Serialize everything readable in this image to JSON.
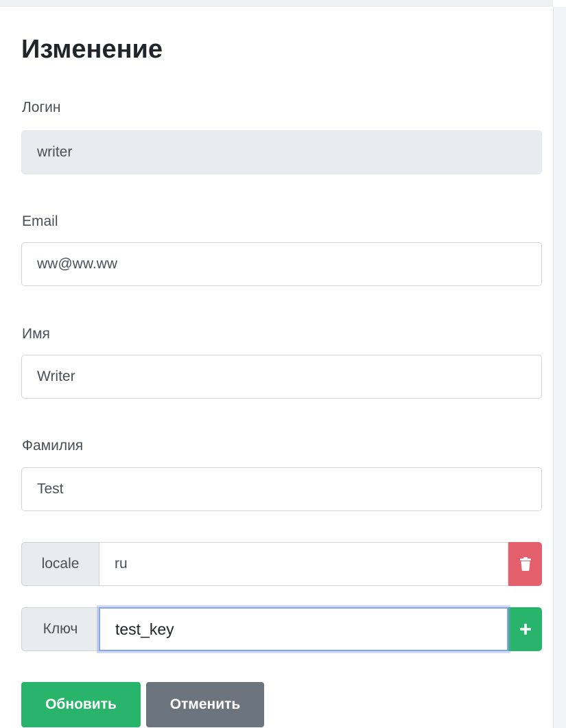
{
  "form": {
    "title": "Изменение",
    "login": {
      "label": "Логин",
      "value": "writer"
    },
    "email": {
      "label": "Email",
      "value": "ww@ww.ww"
    },
    "first_name": {
      "label": "Имя",
      "value": "Writer"
    },
    "last_name": {
      "label": "Фамилия",
      "value": "Test"
    }
  },
  "attributes": [
    {
      "key": "locale",
      "value": "ru",
      "action_icon": "trash-icon"
    }
  ],
  "new_attribute": {
    "key_label": "Ключ",
    "value": "test_key",
    "action_icon": "plus-icon"
  },
  "buttons": {
    "update": "Обновить",
    "cancel": "Отменить"
  },
  "colors": {
    "success": "#28b46a",
    "danger": "#e4606d",
    "secondary": "#6c757d",
    "focus": "#86a5e8"
  }
}
